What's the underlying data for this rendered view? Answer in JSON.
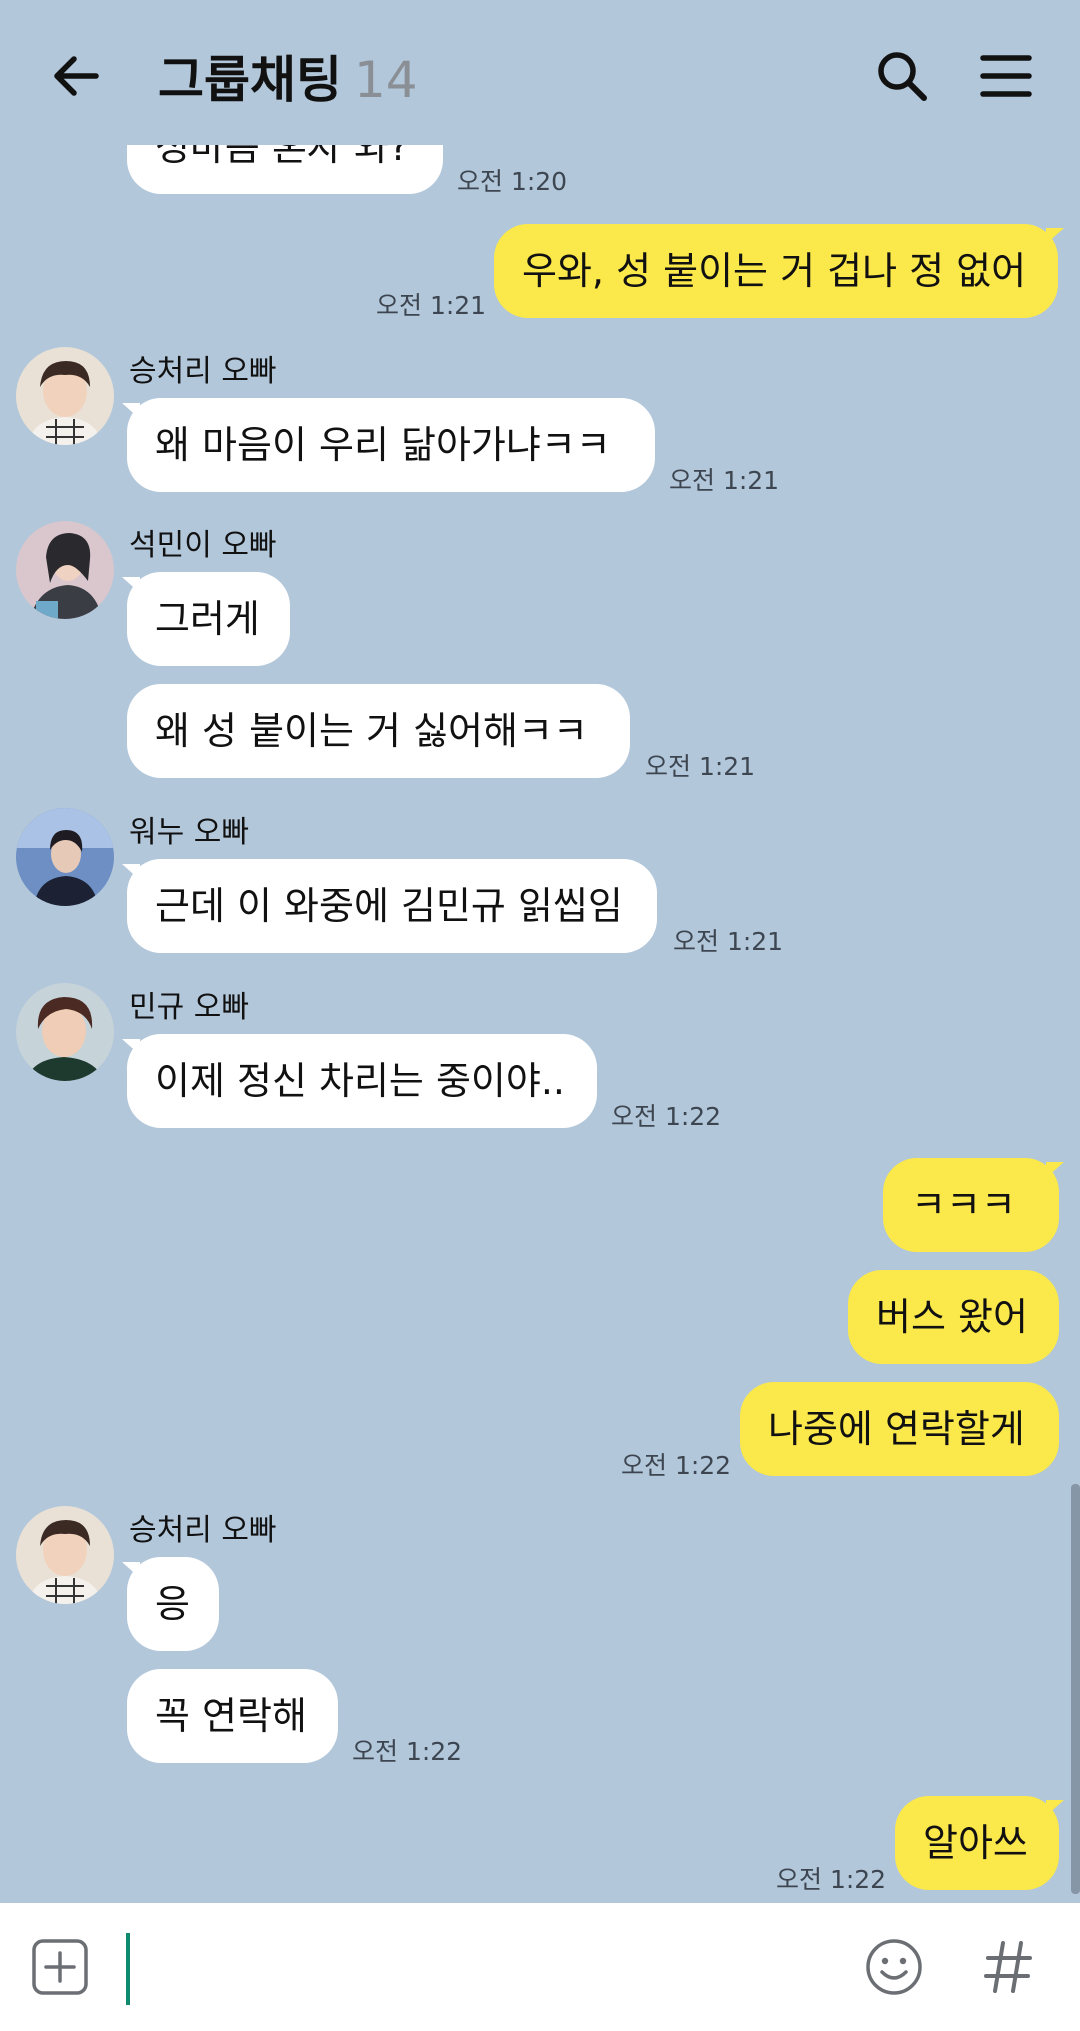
{
  "header": {
    "back_icon": "arrow-left-icon",
    "title": "그룹채팅",
    "member_count": "14",
    "search_icon": "search-icon",
    "menu_icon": "hamburger-menu-icon"
  },
  "messages": {
    "partial_text": "성마음 혼자 와?",
    "partial_time": "오전 1:20",
    "m1_text": "우와, 성 붙이는 거 겁나 정 없어",
    "m1_time": "오전 1:21",
    "s1_name": "승처리 오빠",
    "m2_text": "왜 마음이 우리 닮아가냐ㅋㅋ",
    "m2_time": "오전 1:21",
    "s2_name": "석민이 오빠",
    "m3_text": "그러게",
    "m4_text": "왜 성 붙이는 거 싫어해ㅋㅋ",
    "m4_time": "오전 1:21",
    "s3_name": "워누 오빠",
    "m5_text": "근데 이 와중에 김민규 읽씹임",
    "m5_time": "오전 1:21",
    "s4_name": "민규 오빠",
    "m6_text": "이제 정신 차리는 중이야..",
    "m6_time": "오전 1:22",
    "m7_text": "ㅋㅋㅋ",
    "m8_text": "버스 왔어",
    "m9_text": "나중에 연락할게",
    "m9_time": "오전 1:22",
    "s5_name": "승처리 오빠",
    "m10_text": "응",
    "m11_text": "꼭 연락해",
    "m11_time": "오전 1:22",
    "m12_text": "알아쓰",
    "m12_time": "오전 1:22"
  },
  "input_bar": {
    "add_icon": "plus-square-icon",
    "emoji_icon": "smiley-icon",
    "hashtag_icon": "hashtag-icon"
  },
  "colors": {
    "background": "#b2c7da",
    "outgoing_bubble": "#fbe84a",
    "incoming_bubble": "#ffffff",
    "caret": "#0e8a6f"
  }
}
